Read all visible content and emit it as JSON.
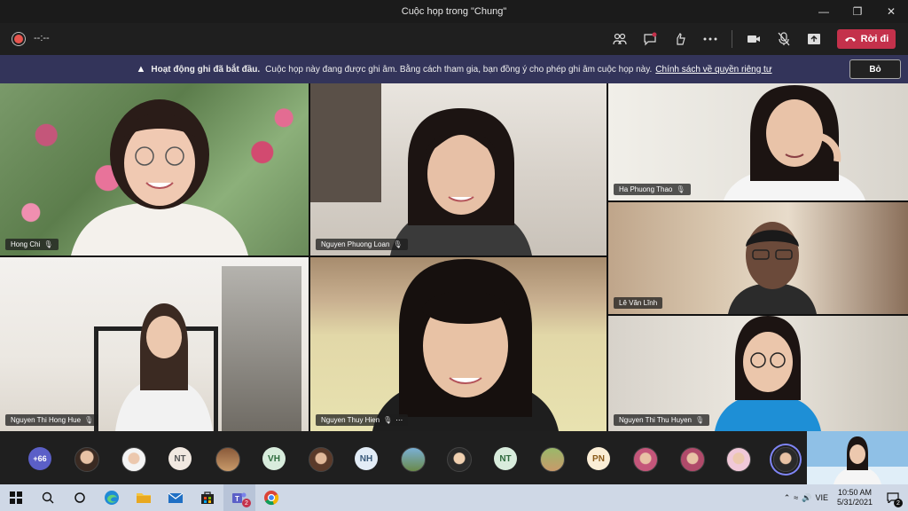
{
  "window": {
    "title": "Cuộc họp trong \"Chung\""
  },
  "toolbar": {
    "timer": "--:--",
    "leave_label": "Rời đi",
    "icons": [
      "participants-icon",
      "chat-icon",
      "reactions-icon",
      "more-icon",
      "camera-icon",
      "mic-off-icon",
      "share-icon"
    ]
  },
  "banner": {
    "heading": "Hoạt động ghi đã bắt đầu.",
    "message": "Cuộc họp này đang được ghi âm. Bằng cách tham gia, bạn đồng ý cho phép ghi âm cuộc họp này.",
    "link": "Chính sách về quyền riêng tư",
    "dismiss_label": "Bỏ"
  },
  "participants": [
    {
      "name": "Hong Chi"
    },
    {
      "name": "Nguyen Phuong Loan"
    },
    {
      "name": "Ha Phuong Thao"
    },
    {
      "name": "Lê Văn Lĩnh"
    },
    {
      "name": "Nguyen Thi Hong Hue"
    },
    {
      "name": "Nguyen Thuy Hien"
    },
    {
      "name": "Nguyen Thi Thu Huyen"
    }
  ],
  "strip": {
    "overflow_count": "+66",
    "initials": [
      "NT",
      "VH",
      "NH",
      "NT",
      "PN"
    ]
  },
  "taskbar": {
    "language": "VIE",
    "time": "10:50 AM",
    "date": "5/31/2021",
    "notifications": "2",
    "teams_badge": "2"
  },
  "colors": {
    "banner_bg": "#33345a",
    "leave_button": "#c4314b",
    "accent": "#5b5fc7"
  }
}
